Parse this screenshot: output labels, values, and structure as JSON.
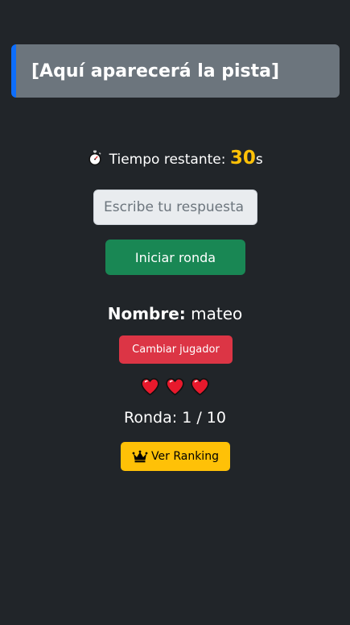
{
  "hint": {
    "text": "[Aquí aparecerá la pista]"
  },
  "timer": {
    "icon": "stopwatch-icon",
    "label": "Tiempo restante:",
    "seconds": "30",
    "unit": "s"
  },
  "answer": {
    "placeholder": "Escribe tu respuesta aquí",
    "value": ""
  },
  "start_button": {
    "label": "Iniciar ronda"
  },
  "player": {
    "name_label": "Nombre:",
    "name_value": "mateo",
    "change_button_label": "Cambiar jugador"
  },
  "lives": {
    "count": 3,
    "icon": "heart-icon"
  },
  "round": {
    "text": "Ronda: 1 / 10"
  },
  "ranking_button": {
    "icon": "crown-icon",
    "label": "Ver Ranking"
  },
  "colors": {
    "background": "#212529",
    "hint_card": "#6c757d",
    "hint_border": "#0d6efd",
    "timer_seconds": "#ffc107",
    "start_button": "#198754",
    "change_button": "#dc3545",
    "ranking_button": "#ffc107",
    "heart": "#e8192c"
  }
}
